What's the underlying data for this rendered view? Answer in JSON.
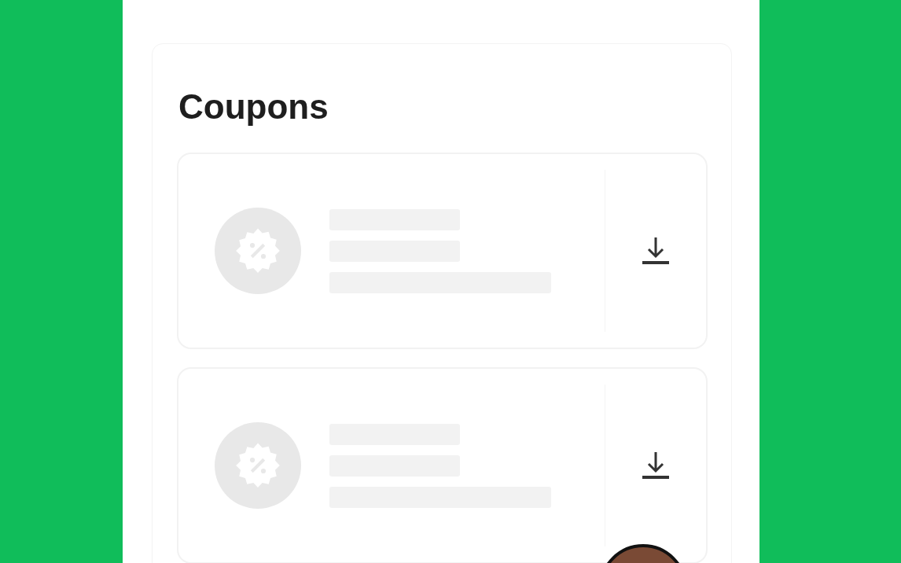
{
  "screen": {
    "title": "Coupons"
  },
  "coupons": [
    {
      "kind": "skeleton"
    },
    {
      "kind": "skeleton"
    }
  ],
  "avatar": {
    "kind": "cartoon"
  }
}
